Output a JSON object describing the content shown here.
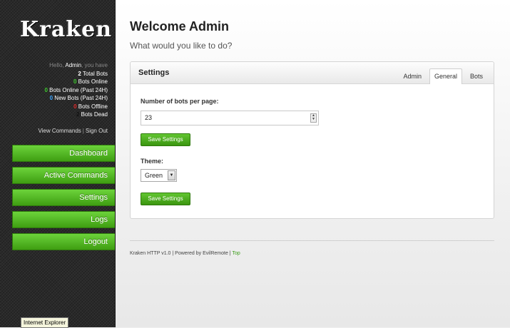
{
  "sidebar": {
    "logo": "Kraken",
    "greeting_prefix": "Hello, ",
    "user": "Admin",
    "greeting_suffix": ", you have",
    "stats": [
      {
        "count": "2",
        "label": " Total Bots",
        "color": "#ffffff"
      },
      {
        "count": "0",
        "label": " Bots Online",
        "color": "#3ecb2e"
      },
      {
        "count": "0",
        "label": " Bots Online (Past 24H)",
        "color": "#3ecb2e"
      },
      {
        "count": "0",
        "label": " New Bots (Past 24H)",
        "color": "#3da5ff"
      },
      {
        "count": "0",
        "label": " Bots Offline",
        "color": "#e02b2b"
      },
      {
        "count": "2",
        "label": " Bots Dead",
        "color": "#111111"
      }
    ],
    "view_commands": "View Commands",
    "separator": "|",
    "sign_out": "Sign Out",
    "nav": [
      "Dashboard",
      "Active Commands",
      "Settings",
      "Logs",
      "Logout"
    ],
    "tooltip": "Internet Explorer"
  },
  "main": {
    "welcome": "Welcome Admin",
    "subtitle": "What would you like to do?",
    "panel": {
      "title": "Settings",
      "tabs": [
        "Admin",
        "General",
        "Bots"
      ],
      "active_tab": "General",
      "bots_label": "Number of bots per page:",
      "bots_value": "23",
      "save_label": "Save Settings",
      "theme_label": "Theme:",
      "theme_value": "Green"
    },
    "footer": {
      "text": "Kraken HTTP v1.0 | Powered by EvilRemote | ",
      "top": "Top"
    }
  },
  "colors": {
    "accent_green": "#4caf1a",
    "sidebar_bg": "#2a2a2a"
  }
}
